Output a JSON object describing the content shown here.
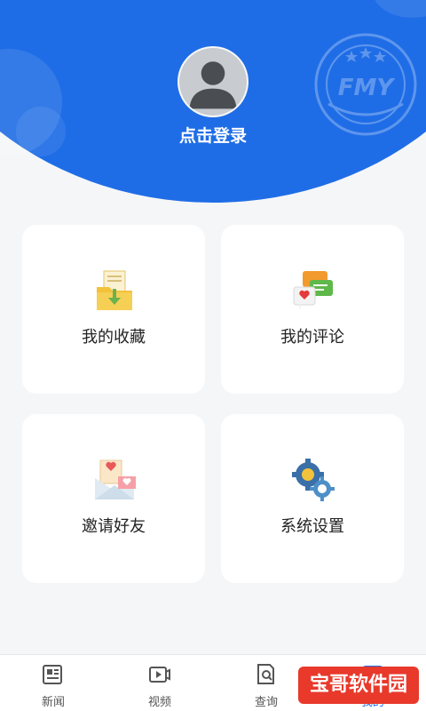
{
  "profile": {
    "login_label": "点击登录",
    "brand_seal_text": "FMY"
  },
  "menu": [
    {
      "label": "我的收藏",
      "icon": "folder-download-icon"
    },
    {
      "label": "我的评论",
      "icon": "chat-bubbles-icon"
    },
    {
      "label": "邀请好友",
      "icon": "invite-envelope-icon"
    },
    {
      "label": "系统设置",
      "icon": "gear-settings-icon"
    }
  ],
  "tabbar": {
    "tabs": [
      {
        "label": "新闻",
        "icon": "newspaper-icon"
      },
      {
        "label": "视频",
        "icon": "video-play-icon"
      },
      {
        "label": "查询",
        "icon": "document-search-icon"
      },
      {
        "label": "我的",
        "icon": "profile-icon",
        "active": true
      }
    ]
  },
  "watermark": {
    "text": "宝哥软件园"
  },
  "colors": {
    "header_blue": "#1f6de6",
    "page_bg": "#f5f6f8",
    "watermark_red": "#e8392b"
  }
}
